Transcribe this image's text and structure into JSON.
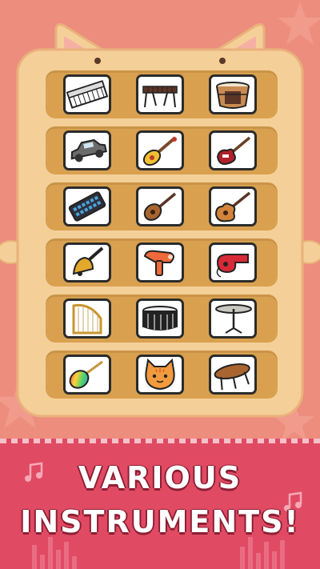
{
  "instrument_grid": {
    "rows": [
      [
        {
          "name": "keyboard"
        },
        {
          "name": "marimba"
        },
        {
          "name": "conga"
        }
      ],
      [
        {
          "name": "car-horn"
        },
        {
          "name": "shamisen"
        },
        {
          "name": "electric-guitar"
        }
      ],
      [
        {
          "name": "launchpad"
        },
        {
          "name": "ukulele"
        },
        {
          "name": "acoustic-guitar"
        }
      ],
      [
        {
          "name": "handbell"
        },
        {
          "name": "hair-dryer"
        },
        {
          "name": "whistle"
        }
      ],
      [
        {
          "name": "harp"
        },
        {
          "name": "snare-drum"
        },
        {
          "name": "cymbal"
        }
      ],
      [
        {
          "name": "maracas"
        },
        {
          "name": "cat-face"
        },
        {
          "name": "table"
        }
      ]
    ]
  },
  "banner": {
    "line1": "VARIOUS",
    "line2": "INSTRUMENTS!"
  },
  "colors": {
    "background": "#ec8d7e",
    "board": "#f5cf98",
    "row": "#d9a14f",
    "banner": "#e14a63"
  }
}
